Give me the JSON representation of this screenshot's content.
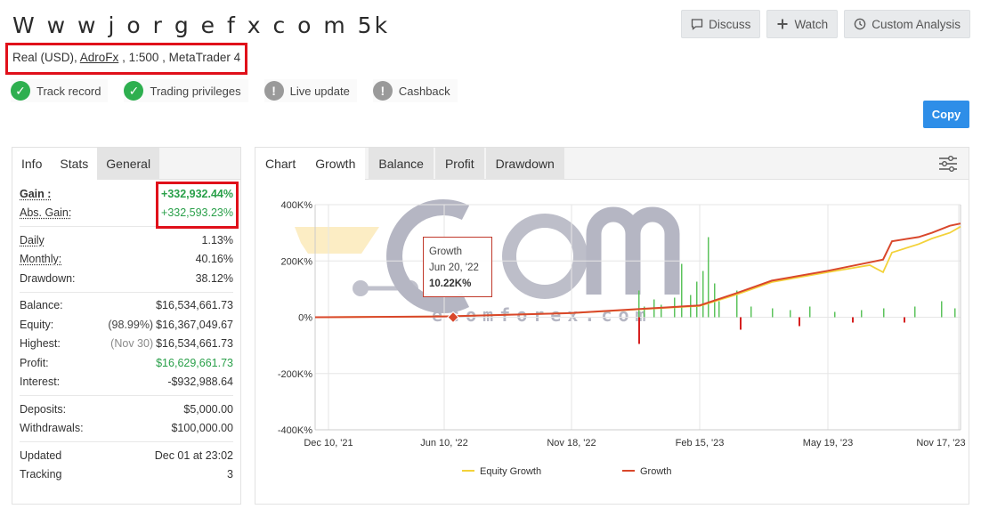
{
  "header": {
    "title": "W w w j o r g e f x c o m 5k",
    "account_type": "Real (USD),",
    "broker": "AdroFx",
    "leverage_platform": ", 1:500 , MetaTrader 4"
  },
  "actions": {
    "discuss": "Discuss",
    "watch": "Watch",
    "custom_analysis": "Custom Analysis",
    "copy": "Copy"
  },
  "badges": [
    {
      "label": "Track record",
      "status": "ok"
    },
    {
      "label": "Trading privileges",
      "status": "ok"
    },
    {
      "label": "Live update",
      "status": "warn"
    },
    {
      "label": "Cashback",
      "status": "warn"
    }
  ],
  "left_tabs": [
    "Info",
    "Stats",
    "General"
  ],
  "stats": {
    "gain_label": "Gain :",
    "gain": "+332,932.44%",
    "abs_gain_label": "Abs. Gain:",
    "abs_gain": "+332,593.23%",
    "daily_label": "Daily",
    "daily": "1.13%",
    "monthly_label": "Monthly:",
    "monthly": "40.16%",
    "drawdown_label": "Drawdown:",
    "drawdown": "38.12%",
    "balance_label": "Balance:",
    "balance": "$16,534,661.73",
    "equity_label": "Equity:",
    "equity_pct": "(98.99%)",
    "equity": "$16,367,049.67",
    "highest_label": "Highest:",
    "highest_date": "(Nov 30)",
    "highest": "$16,534,661.73",
    "profit_label": "Profit:",
    "profit": "$16,629,661.73",
    "interest_label": "Interest:",
    "interest": "-$932,988.64",
    "deposits_label": "Deposits:",
    "deposits": "$5,000.00",
    "withdrawals_label": "Withdrawals:",
    "withdrawals": "$100,000.00",
    "updated_label": "Updated",
    "updated": "Dec 01 at 23:02",
    "tracking_label": "Tracking",
    "tracking": "3"
  },
  "chart_tabs": [
    "Chart",
    "Growth",
    "Balance",
    "Profit",
    "Drawdown"
  ],
  "tooltip": {
    "series": "Growth",
    "date": "Jun 20, '22",
    "value": "10.22K%"
  },
  "watermark": {
    "text": "ecomforex.com"
  },
  "colors": {
    "growth": "#d9472b",
    "equity": "#f3d23a",
    "bar_green": "#5cc35c",
    "bar_red": "#d62020",
    "accent": "#2e8ee8"
  },
  "chart_data": {
    "type": "line",
    "y_ticks": [
      "400K%",
      "200K%",
      "0%",
      "-200K%",
      "-400K%"
    ],
    "x_ticks": [
      "Dec 10, '21",
      "Jun 10, '22",
      "Nov 18, '22",
      "Feb 15, '23",
      "May 19, '23",
      "Nov 17, '23"
    ],
    "ylim": [
      -400000,
      400000
    ],
    "grid": true,
    "legend_position": "bottom",
    "series": [
      {
        "name": "Equity Growth",
        "x": [
          "Dec 10, '21",
          "Jun 10, '22",
          "Nov 18, '22",
          "Feb 15, '23",
          "Mar 15, '23",
          "Apr 10, '23",
          "May 19, '23",
          "Jun 20, '23",
          "Jul 15, '23",
          "Aug 10, '23",
          "Sep 20, '23",
          "Oct 10, '23",
          "Nov 17, '23",
          "Dec 01, '23"
        ],
        "values": [
          0,
          3000,
          15000,
          40000,
          80000,
          125000,
          160000,
          185000,
          160000,
          230000,
          260000,
          280000,
          300000,
          322000
        ]
      },
      {
        "name": "Growth",
        "x": [
          "Dec 10, '21",
          "Jun 10, '22",
          "Nov 18, '22",
          "Feb 15, '23",
          "Mar 15, '23",
          "Apr 10, '23",
          "May 19, '23",
          "Jun 20, '23",
          "Jul 15, '23",
          "Aug 10, '23",
          "Sep 20, '23",
          "Oct 10, '23",
          "Nov 17, '23",
          "Dec 01, '23"
        ],
        "values": [
          0,
          3000,
          15000,
          42000,
          85000,
          130000,
          165000,
          195000,
          205000,
          270000,
          285000,
          300000,
          325000,
          332932
        ]
      }
    ]
  }
}
